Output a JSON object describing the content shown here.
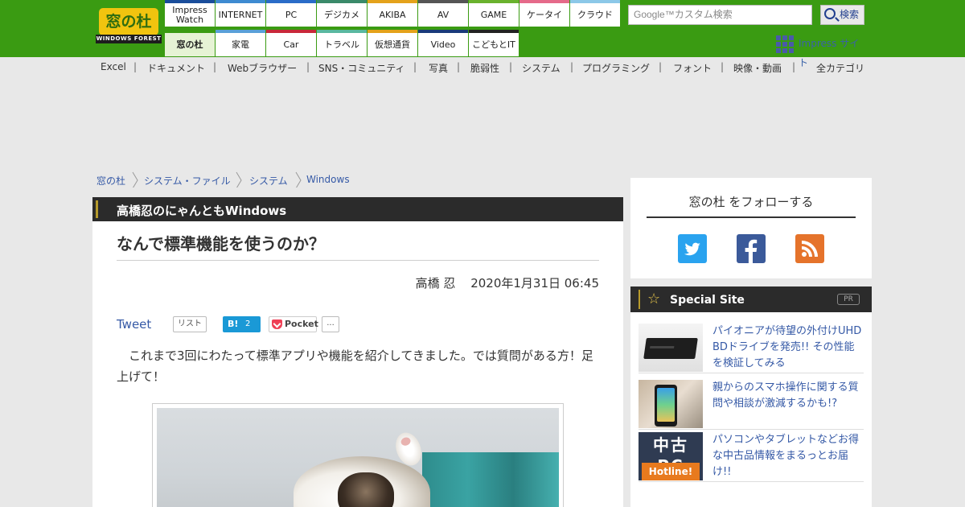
{
  "logo": {
    "mark": "窓の杜",
    "sub": "WINDOWS FOREST"
  },
  "nav": {
    "row1": [
      {
        "label": "Impress Watch",
        "color": "#1a4d9b"
      },
      {
        "label": "INTERNET",
        "color": "#3e8bd1"
      },
      {
        "label": "PC",
        "color": "#2a6cc8"
      },
      {
        "label": "デジカメ",
        "color": "#3a8a6a"
      },
      {
        "label": "AKIBA",
        "color": "#e4a21b"
      },
      {
        "label": "AV",
        "color": "#555555"
      },
      {
        "label": "GAME",
        "color": "#6ab22e"
      },
      {
        "label": "ケータイ",
        "color": "#e56a8a"
      },
      {
        "label": "クラウド",
        "color": "#8cc8e8"
      }
    ],
    "row2": [
      {
        "label": "窓の杜",
        "color": "#3a9b12"
      },
      {
        "label": "家電",
        "color": "#5aa0d8"
      },
      {
        "label": "Car",
        "color": "#c8283a"
      },
      {
        "label": "トラベル",
        "color": "#5ab8a0"
      },
      {
        "label": "仮想通貨",
        "color": "#e4a21b"
      },
      {
        "label": "Video",
        "color": "#1a3a7a"
      },
      {
        "label": "こどもとIT",
        "color": "#222222"
      }
    ]
  },
  "search": {
    "placeholder": "Google™カスタム検索",
    "button": "検索"
  },
  "impress_site": "Impress サイト",
  "categories": [
    "Excel",
    "ドキュメント",
    "Webブラウザー",
    "SNS・コミュニティ",
    "写真",
    "脆弱性",
    "システム",
    "プログラミング",
    "フォント",
    "映像・動画"
  ],
  "all_categories": "全カテゴリ",
  "breadcrumb": [
    "窓の杜",
    "システム・ファイル",
    "システム",
    "Windows"
  ],
  "article": {
    "series": "高橋忍のにゃんともWindows",
    "title": "なんで標準機能を使うのか？",
    "author": "高橋 忍",
    "date": "2020年1月31日 06:45",
    "body": "　これまで3回にわたって標準アプリや機能を紹介してきました。では質問がある方！足上げて！"
  },
  "share": {
    "tweet": "Tweet",
    "list": "リスト",
    "hatena_label": "B!",
    "hatena_count": "2",
    "pocket": "Pocket",
    "pocket_count": "..."
  },
  "follow": {
    "title": "窓の杜 をフォローする"
  },
  "special": {
    "title": "Special Site",
    "pr": "PR",
    "items": [
      {
        "text": "パイオニアが待望の外付けUHD BDドライブを発売!! その性能を検証してみる"
      },
      {
        "text": "親からのスマホ操作に関する質問や相談が激減するかも!?"
      },
      {
        "text": "パソコンやタブレットなどお得な中古品情報をまるっとお届け!!"
      }
    ],
    "thumb3": {
      "line1": "中古PC",
      "line2": "Hotline!"
    }
  }
}
